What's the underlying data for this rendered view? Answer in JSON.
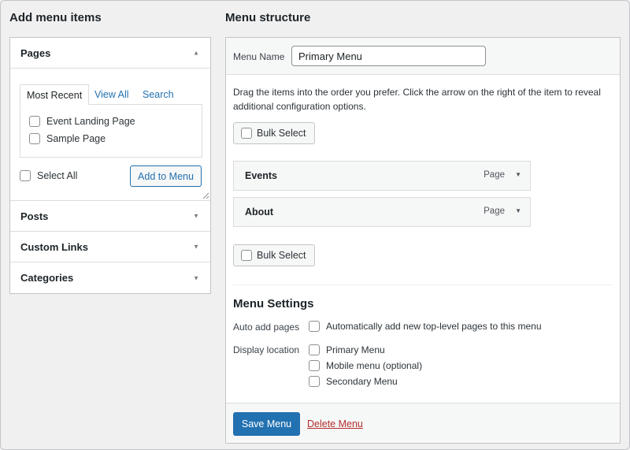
{
  "left": {
    "title": "Add menu items",
    "pages": {
      "label": "Pages",
      "tabs": [
        "Most Recent",
        "View All",
        "Search"
      ],
      "items": [
        "Event Landing Page",
        "Sample Page"
      ],
      "select_all": "Select All",
      "add_button": "Add to Menu"
    },
    "sections": [
      "Posts",
      "Custom Links",
      "Categories"
    ]
  },
  "right": {
    "title": "Menu structure",
    "menu_name_label": "Menu Name",
    "menu_name_value": "Primary Menu",
    "instructions": "Drag the items into the order you prefer. Click the arrow on the right of the item to reveal additional configuration options.",
    "bulk_select": "Bulk Select",
    "items": [
      {
        "title": "Events",
        "type": "Page"
      },
      {
        "title": "About",
        "type": "Page"
      }
    ],
    "settings": {
      "title": "Menu Settings",
      "auto_add_label": "Auto add pages",
      "auto_add_option": "Automatically add new top-level pages to this menu",
      "display_label": "Display location",
      "locations": [
        "Primary Menu",
        "Mobile menu (optional)",
        "Secondary Menu"
      ]
    },
    "save_button": "Save Menu",
    "delete_link": "Delete Menu"
  },
  "colors": {
    "accent": "#2271b1",
    "danger": "#b32d2e",
    "background": "#f0f0f1",
    "panel": "#ffffff",
    "border": "#c3c4c7"
  },
  "icons": {
    "collapse": "arrow-up-icon",
    "expand": "arrow-down-icon"
  }
}
